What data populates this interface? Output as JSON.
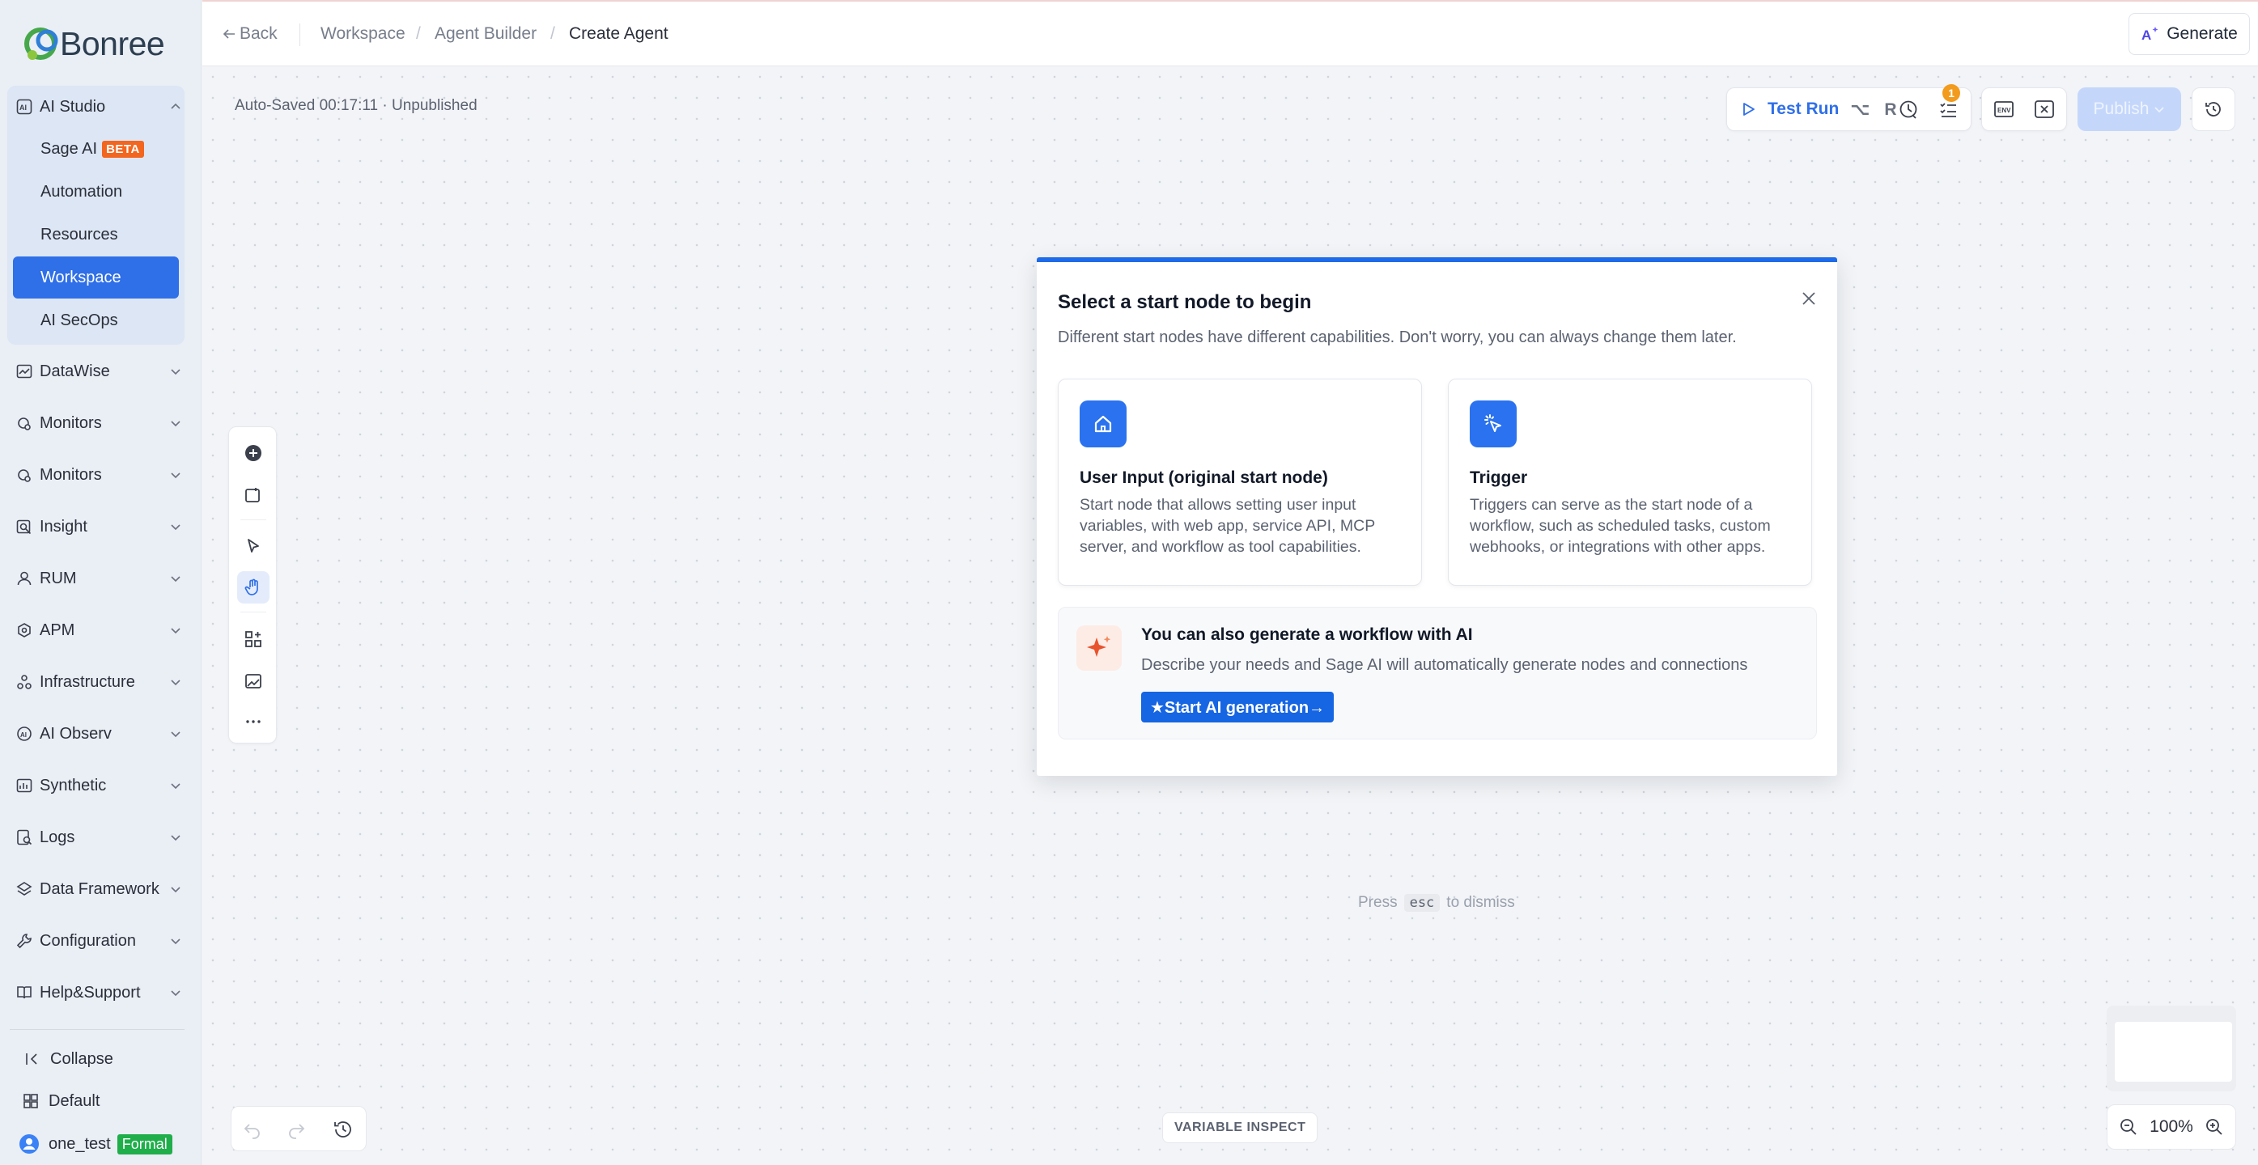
{
  "brand": {
    "name": "Bonree"
  },
  "sidebar": {
    "ai_studio": {
      "label": "AI Studio",
      "items": [
        {
          "label": "Sage AI",
          "badge": "BETA"
        },
        {
          "label": "Automation"
        },
        {
          "label": "Resources"
        },
        {
          "label": "Workspace",
          "active": true
        },
        {
          "label": "AI SecOps"
        }
      ]
    },
    "sections": [
      {
        "label": "DataWise",
        "icon": "chart-icon"
      },
      {
        "label": "Monitors",
        "icon": "monitor-icon"
      },
      {
        "label": "Monitors",
        "icon": "monitor-icon"
      },
      {
        "label": "Insight",
        "icon": "insight-icon"
      },
      {
        "label": "RUM",
        "icon": "user-icon"
      },
      {
        "label": "APM",
        "icon": "apm-icon"
      },
      {
        "label": "Infrastructure",
        "icon": "infrastructure-icon"
      },
      {
        "label": "AI Observ",
        "icon": "ai-observ-icon"
      },
      {
        "label": "Synthetic",
        "icon": "synthetic-icon"
      },
      {
        "label": "Logs",
        "icon": "logs-icon"
      },
      {
        "label": "Data Framework",
        "icon": "data-framework-icon"
      },
      {
        "label": "Configuration",
        "icon": "configuration-icon"
      },
      {
        "label": "Help&Support",
        "icon": "book-icon"
      }
    ],
    "footer": {
      "collapse": "Collapse",
      "default": "Default",
      "user": "one_test",
      "env_badge": "Formal"
    }
  },
  "topbar": {
    "back": "Back",
    "breadcrumb": [
      "Workspace",
      "Agent Builder",
      "Create Agent"
    ],
    "generate": "Generate"
  },
  "canvas": {
    "autosave": "Auto-Saved 00:17:11 · Unpublished",
    "test_run": "Test Run",
    "test_run_shortcut": "⌥ R",
    "checklist_count": "1",
    "publish": "Publish",
    "dismiss_hint": {
      "press": "Press",
      "key": "esc",
      "suffix": "to dismiss"
    },
    "variable_inspect": "VARIABLE INSPECT",
    "zoom": "100%"
  },
  "dialog": {
    "title": "Select a start node to begin",
    "description": "Different start nodes have different capabilities. Don't worry, you can always change them later.",
    "cards": [
      {
        "title": "User Input (original start node)",
        "description": "Start node that allows setting user input variables, with web app, service API, MCP server, and workflow as tool capabilities."
      },
      {
        "title": "Trigger",
        "description": "Triggers can serve as the start node of a workflow, such as scheduled tasks, custom webhooks, or integrations with other apps."
      }
    ],
    "ai": {
      "title": "You can also generate a workflow with AI",
      "description": "Describe your needs and Sage AI will automatically generate nodes and connections",
      "button": "★Start AI generation→"
    }
  },
  "colors": {
    "accent": "#2f6fe8",
    "dialog_top": "#1e6bea",
    "beta": "#f2661f",
    "formal": "#1fae4a",
    "badge": "#f29b1c"
  }
}
